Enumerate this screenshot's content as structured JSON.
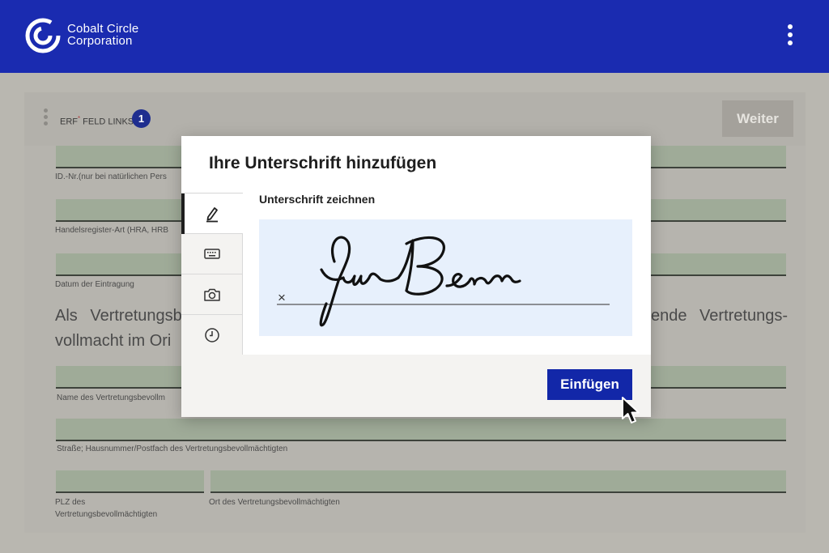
{
  "header": {
    "brand_line1": "Cobalt Circle",
    "brand_line2": "Corporation",
    "logo_icon": "cobalt-circle-logo",
    "menu_icon": "kebab-menu-icon",
    "background": "#1a2bb0"
  },
  "formbar": {
    "required_label": "ERF",
    "required_marker": "*",
    "required_suffix": " FELD LINKS",
    "required_count": "1",
    "next_button": "Weiter"
  },
  "form": {
    "fields": [
      {
        "label": "ID.-Nr.(nur bei natürlichen Pers"
      },
      {
        "label": "Handelsregister-Art (HRA, HRB"
      },
      {
        "label": "Datum der Eintragung"
      },
      {
        "label": "Name des Vertretungsbevollm"
      },
      {
        "label": "Straße; Hausnummer/Postfach des Vertretungsbevollmächtigten"
      },
      {
        "label_line1": "PLZ des",
        "label_line2": "Vertretungsbevollmächtigten"
      },
      {
        "label": "Ort des Vertretungsbevollmächtigten"
      }
    ],
    "paragraph_line1_left": "Als Vertretungsb",
    "paragraph_line1_right": "ende Vertretungs-",
    "paragraph_line2": "vollmacht im Ori"
  },
  "modal": {
    "title": "Ihre Unterschrift hinzufügen",
    "section_label": "Unterschrift zeichnen",
    "tabs": [
      {
        "icon": "pen-icon",
        "active": true
      },
      {
        "icon": "keyboard-icon",
        "active": false
      },
      {
        "icon": "camera-icon",
        "active": false
      },
      {
        "icon": "clock-icon",
        "active": false
      }
    ],
    "signature_marker": "×",
    "signature_text": "JenBern",
    "insert_button": "Einfügen",
    "insert_button_color": "#1227a8",
    "canvas_color": "#e7f0fc"
  }
}
